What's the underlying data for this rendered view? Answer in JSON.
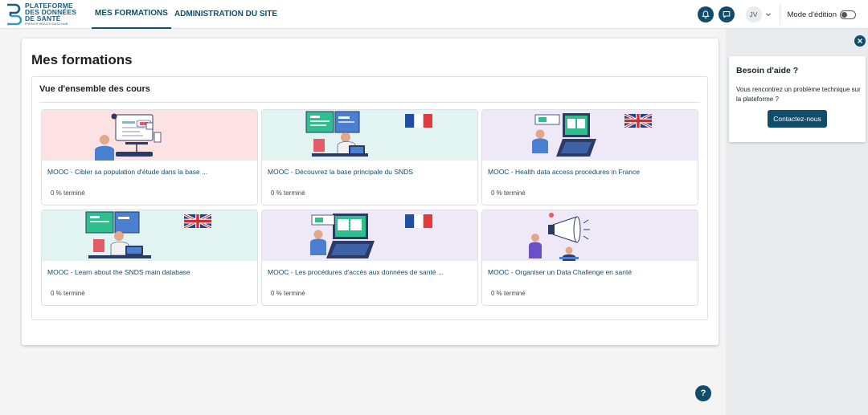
{
  "logo": {
    "line1": "PLATEFORME",
    "line2": "DES DONNÉES",
    "line3": "DE SANTÉ",
    "sub": "FRENCH HEALTH DATA HUB"
  },
  "nav": {
    "items": [
      {
        "label": "MES FORMATIONS",
        "active": true
      },
      {
        "label": "ADMINISTRATION DU SITE",
        "active": false
      }
    ]
  },
  "user": {
    "initials": "JV"
  },
  "edit_mode": {
    "label": "Mode d'édition",
    "on": false
  },
  "page": {
    "title": "Mes formations"
  },
  "block": {
    "title": "Vue d'ensemble des cours"
  },
  "courses": [
    {
      "title": "MOOC - Cibler sa population d'étude dans la base ...",
      "progress": "0 % terminé",
      "bg": "#fde2e4",
      "flag": "none"
    },
    {
      "title": "MOOC - Découvrez la base principale du SNDS",
      "progress": "0 % terminé",
      "bg": "#e2f4f1",
      "flag": "fr"
    },
    {
      "title": "MOOC - Health data access procedures in France",
      "progress": "0 % terminé",
      "bg": "#efe8f7",
      "flag": "uk"
    },
    {
      "title": "MOOC - Learn about the SNDS main database",
      "progress": "0 % terminé",
      "bg": "#e2f4f1",
      "flag": "uk"
    },
    {
      "title": "MOOC - Les procédures d'accès aux données de santé ...",
      "progress": "0 % terminé",
      "bg": "#efe8f7",
      "flag": "fr"
    },
    {
      "title": "MOOC - Organiser un Data Challenge en santé",
      "progress": "0 % terminé",
      "bg": "#efe8f7",
      "flag": "none"
    }
  ],
  "help": {
    "title": "Besoin d'aide ?",
    "text": "Vous rencontrez un problème technique sur la plateforme ?",
    "button": "Contactez-nous"
  },
  "fab": {
    "label": "?"
  },
  "colors": {
    "primary": "#0f4d6b",
    "link": "#0f6cbf"
  }
}
